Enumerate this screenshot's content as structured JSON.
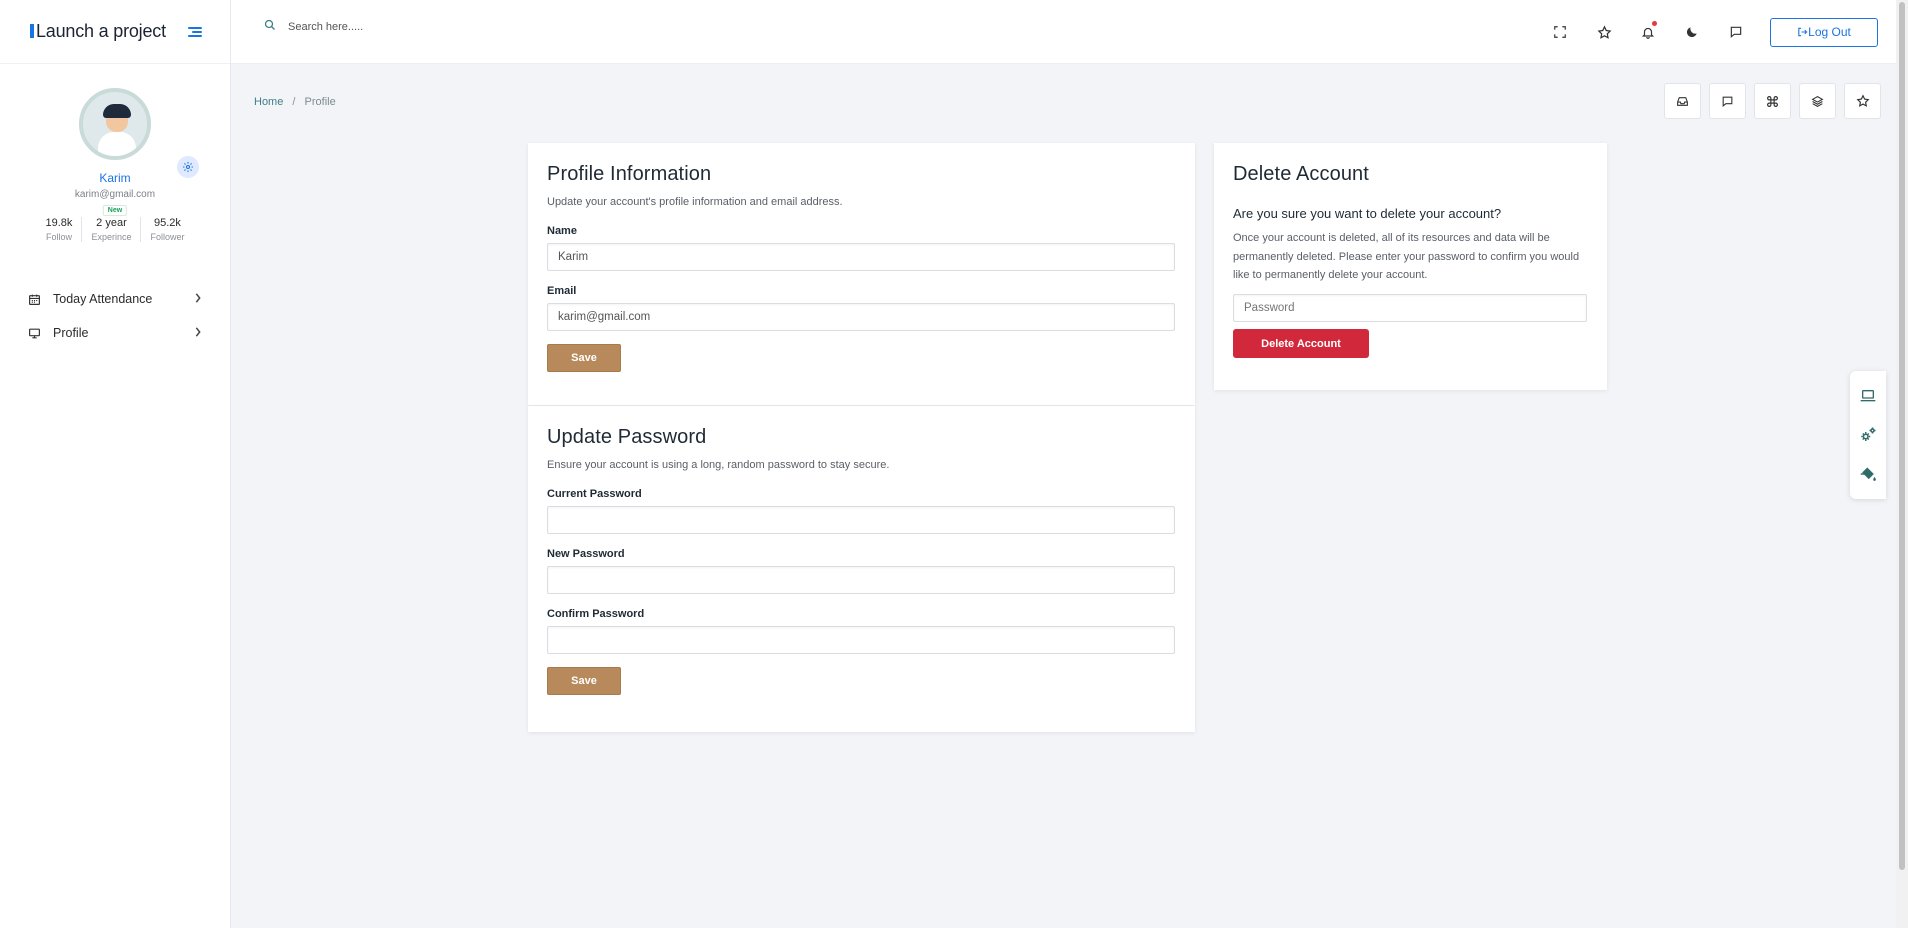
{
  "brand": {
    "name": "Launch a project"
  },
  "sidebar": {
    "user": {
      "name": "Karim",
      "email": "karim@gmail.com",
      "badge": "New"
    },
    "stats": [
      {
        "value": "19.8k",
        "label": "Follow"
      },
      {
        "value": "2 year",
        "label": "Experince"
      },
      {
        "value": "95.2k",
        "label": "Follower"
      }
    ],
    "items": [
      {
        "label": "Today Attendance",
        "icon": "calendar-icon"
      },
      {
        "label": "Profile",
        "icon": "monitor-icon"
      }
    ]
  },
  "topbar": {
    "search_placeholder": "Search here.....",
    "logout_label": "Log Out",
    "icons": [
      "fullscreen-icon",
      "star-icon",
      "bell-icon",
      "moon-icon",
      "chat-icon"
    ]
  },
  "breadcrumb": {
    "home": "Home",
    "current": "Profile",
    "separator": "/"
  },
  "quick_icons": [
    "inbox-icon",
    "message-icon",
    "command-icon",
    "layers-icon",
    "star-icon"
  ],
  "profile_info": {
    "title": "Profile Information",
    "description": "Update your account's profile information and email address.",
    "name_label": "Name",
    "name_value": "Karim",
    "email_label": "Email",
    "email_value": "karim@gmail.com",
    "save_label": "Save"
  },
  "update_password": {
    "title": "Update Password",
    "description": "Ensure your account is using a long, random password to stay secure.",
    "current_label": "Current Password",
    "new_label": "New Password",
    "confirm_label": "Confirm Password",
    "save_label": "Save"
  },
  "delete_account": {
    "title": "Delete Account",
    "question": "Are you sure you want to delete your account?",
    "description": "Once your account is deleted, all of its resources and data will be permanently deleted. Please enter your password to confirm you would like to permanently delete your account.",
    "password_placeholder": "Password",
    "button_label": "Delete Account"
  },
  "side_dock": [
    "laptop-icon",
    "gears-icon",
    "paint-bucket-icon"
  ],
  "colors": {
    "accent": "#1b74e4",
    "save": "#b8895a",
    "danger": "#d1283b",
    "background": "#f3f4f8"
  }
}
